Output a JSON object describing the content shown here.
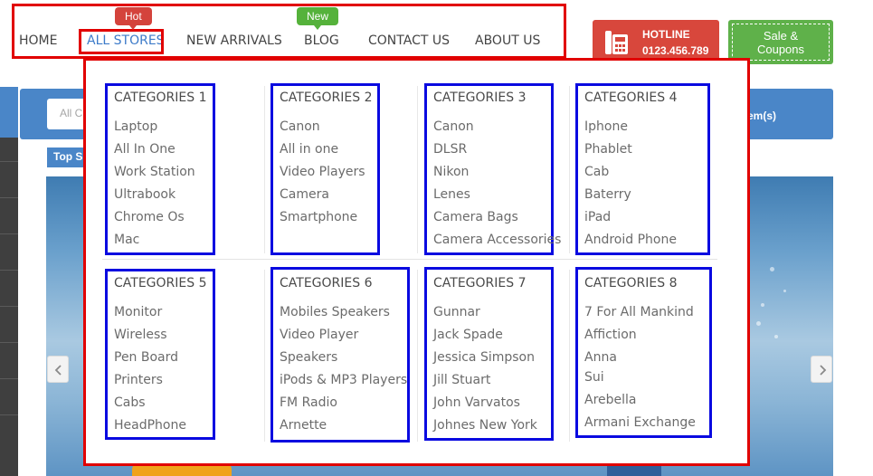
{
  "nav": {
    "items": [
      {
        "label": "HOME"
      },
      {
        "label": "ALL STORES",
        "badge": "Hot"
      },
      {
        "label": "NEW ARRIVALS"
      },
      {
        "label": "BLOG",
        "badge": "New"
      },
      {
        "label": "CONTACT US"
      },
      {
        "label": "ABOUT US"
      }
    ],
    "active_index": 1
  },
  "hotline": {
    "title": "HOTLINE",
    "number": "0123.456.789"
  },
  "coupons": {
    "line1": "Sale &",
    "line2": "Coupons"
  },
  "search": {
    "placeholder": "All C",
    "items_text": "em(s)"
  },
  "tabs": {
    "top_sale": "Top S"
  },
  "mega_menu": {
    "categories": [
      {
        "title": "CATEGORIES 1",
        "items": [
          "Laptop",
          "All In One",
          "Work Station",
          "Ultrabook",
          "Chrome Os",
          "Mac"
        ]
      },
      {
        "title": "CATEGORIES 2",
        "items": [
          "Canon",
          "All in one",
          "Video Players",
          "Camera",
          "Smartphone"
        ]
      },
      {
        "title": "CATEGORIES 3",
        "items": [
          "Canon",
          "DLSR",
          "Nikon",
          "Lenes",
          "Camera Bags",
          "Camera Accessories"
        ]
      },
      {
        "title": "CATEGORIES 4",
        "items": [
          "Iphone",
          "Phablet",
          "Cab",
          "Baterry",
          "iPad",
          "Android Phone"
        ]
      },
      {
        "title": "CATEGORIES 5",
        "items": [
          "Monitor",
          "Wireless",
          "Pen Board",
          "Printers",
          "Cabs",
          "HeadPhone"
        ]
      },
      {
        "title": "CATEGORIES 6",
        "items": [
          "Mobiles Speakers",
          "Video Player",
          "Speakers",
          "iPods & MP3 Players",
          "FM Radio",
          "Arnette"
        ]
      },
      {
        "title": "CATEGORIES 7",
        "items": [
          "Gunnar",
          "Jack Spade",
          "Jessica Simpson",
          "Jill Stuart",
          "John Varvatos",
          "Johnes New York"
        ]
      },
      {
        "title": "CATEGORIES 8",
        "items": [
          "7 For All Mankind",
          "Affiction",
          "Anna",
          "Sui",
          "Arebella",
          "Armani Exchange"
        ]
      }
    ]
  },
  "colors": {
    "highlight_red": "#e10000",
    "highlight_blue": "#0a0ae0",
    "active_link": "#3d7bc9",
    "hot_badge": "#d4433c",
    "new_badge": "#55b23b",
    "hotline_bg": "#d8473c",
    "coupons_bg": "#5fb14a",
    "band_blue": "#4a86c8"
  }
}
